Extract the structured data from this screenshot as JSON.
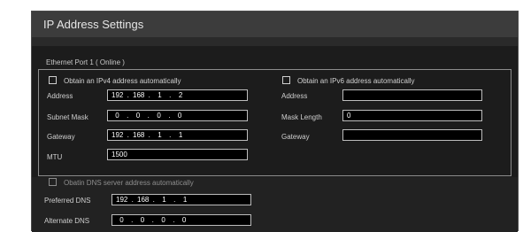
{
  "window": {
    "title": "IP Address Settings"
  },
  "ethernet": {
    "section_label": "Ethernet Port 1 ( Online )",
    "ipv4": {
      "auto_label": "Obtain an IPv4 address automatically",
      "auto_checked": false,
      "address_label": "Address",
      "address_value": "192 . 168 .  1  .  2",
      "subnet_label": "Subnet Mask",
      "subnet_value": " 0  .  0  .  0  .  0",
      "gateway_label": "Gateway",
      "gateway_value": "192 . 168 .  1  .  1",
      "mtu_label": "MTU",
      "mtu_value": "1500"
    },
    "ipv6": {
      "auto_label": "Obtain an IPv6 address automatically",
      "auto_checked": false,
      "address_label": "Address",
      "address_value": "",
      "mask_label": "Mask Length",
      "mask_value": "0",
      "gateway_label": "Gateway",
      "gateway_value": ""
    }
  },
  "dns": {
    "auto_label": "Obatin DNS server address automatically",
    "auto_checked": false,
    "preferred_label": "Preferred DNS",
    "preferred_value": "192 . 168 .  1  .  1",
    "alternate_label": "Alternate DNS",
    "alternate_value": " 0  .  0  .  0  .  0"
  }
}
